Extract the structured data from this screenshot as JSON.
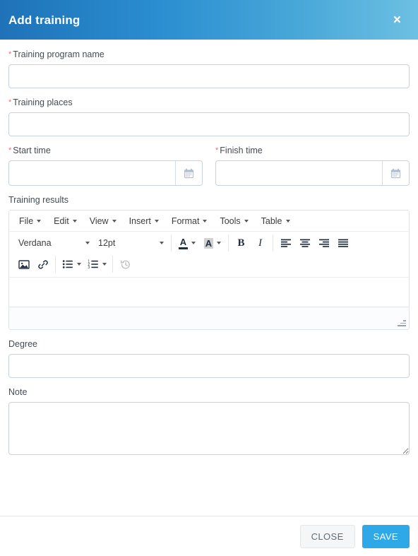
{
  "header": {
    "title": "Add training",
    "close_icon": "close-icon",
    "close_label": "×",
    "gradient_from": "#1f72b8",
    "gradient_to": "#6cc0e2"
  },
  "form": {
    "training_program_name": {
      "label": "Training program name",
      "required": true,
      "required_marker": "*",
      "value": "",
      "placeholder": ""
    },
    "training_places": {
      "label": "Training places",
      "required": true,
      "required_marker": "*",
      "value": "",
      "placeholder": ""
    },
    "start_time": {
      "label": "Start time",
      "required": true,
      "required_marker": "*",
      "value": "",
      "placeholder": "",
      "icon": "calendar-icon"
    },
    "finish_time": {
      "label": "Finish time",
      "required": true,
      "required_marker": "*",
      "value": "",
      "placeholder": "",
      "icon": "calendar-icon"
    },
    "training_results": {
      "label": "Training results",
      "required": false,
      "value": ""
    },
    "degree": {
      "label": "Degree",
      "required": false,
      "value": "",
      "placeholder": ""
    },
    "note": {
      "label": "Note",
      "required": false,
      "value": "",
      "placeholder": ""
    }
  },
  "editor": {
    "menubar": [
      {
        "label": "File"
      },
      {
        "label": "Edit"
      },
      {
        "label": "View"
      },
      {
        "label": "Insert"
      },
      {
        "label": "Format"
      },
      {
        "label": "Tools"
      },
      {
        "label": "Table"
      }
    ],
    "font_family": "Verdana",
    "font_size": "12pt",
    "toolbar_row1": [
      {
        "name": "text-color-button",
        "icon": "letter-a-underline-icon",
        "label": "A"
      },
      {
        "name": "background-color-button",
        "icon": "letter-a-highlight-icon",
        "label": "A"
      },
      {
        "name": "bold-button",
        "icon": "bold-icon",
        "label": "B"
      },
      {
        "name": "italic-button",
        "icon": "italic-icon",
        "label": "I"
      },
      {
        "name": "align-left-button",
        "icon": "align-left-icon"
      },
      {
        "name": "align-center-button",
        "icon": "align-center-icon"
      },
      {
        "name": "align-right-button",
        "icon": "align-right-icon"
      },
      {
        "name": "align-justify-button",
        "icon": "align-justify-icon"
      }
    ],
    "toolbar_row2": [
      {
        "name": "insert-image-button",
        "icon": "image-icon"
      },
      {
        "name": "insert-link-button",
        "icon": "link-icon"
      },
      {
        "name": "bullet-list-button",
        "icon": "bullet-list-icon"
      },
      {
        "name": "numbered-list-button",
        "icon": "numbered-list-icon"
      },
      {
        "name": "restore-draft-button",
        "icon": "history-clock-icon",
        "disabled": true
      }
    ],
    "content": "",
    "statusbar": "",
    "resize_handle": "resize-grip-icon"
  },
  "footer": {
    "close_label": "CLOSE",
    "save_label": "SAVE",
    "save_color": "#2fa8e8",
    "close_color": "#f4f6f8"
  }
}
